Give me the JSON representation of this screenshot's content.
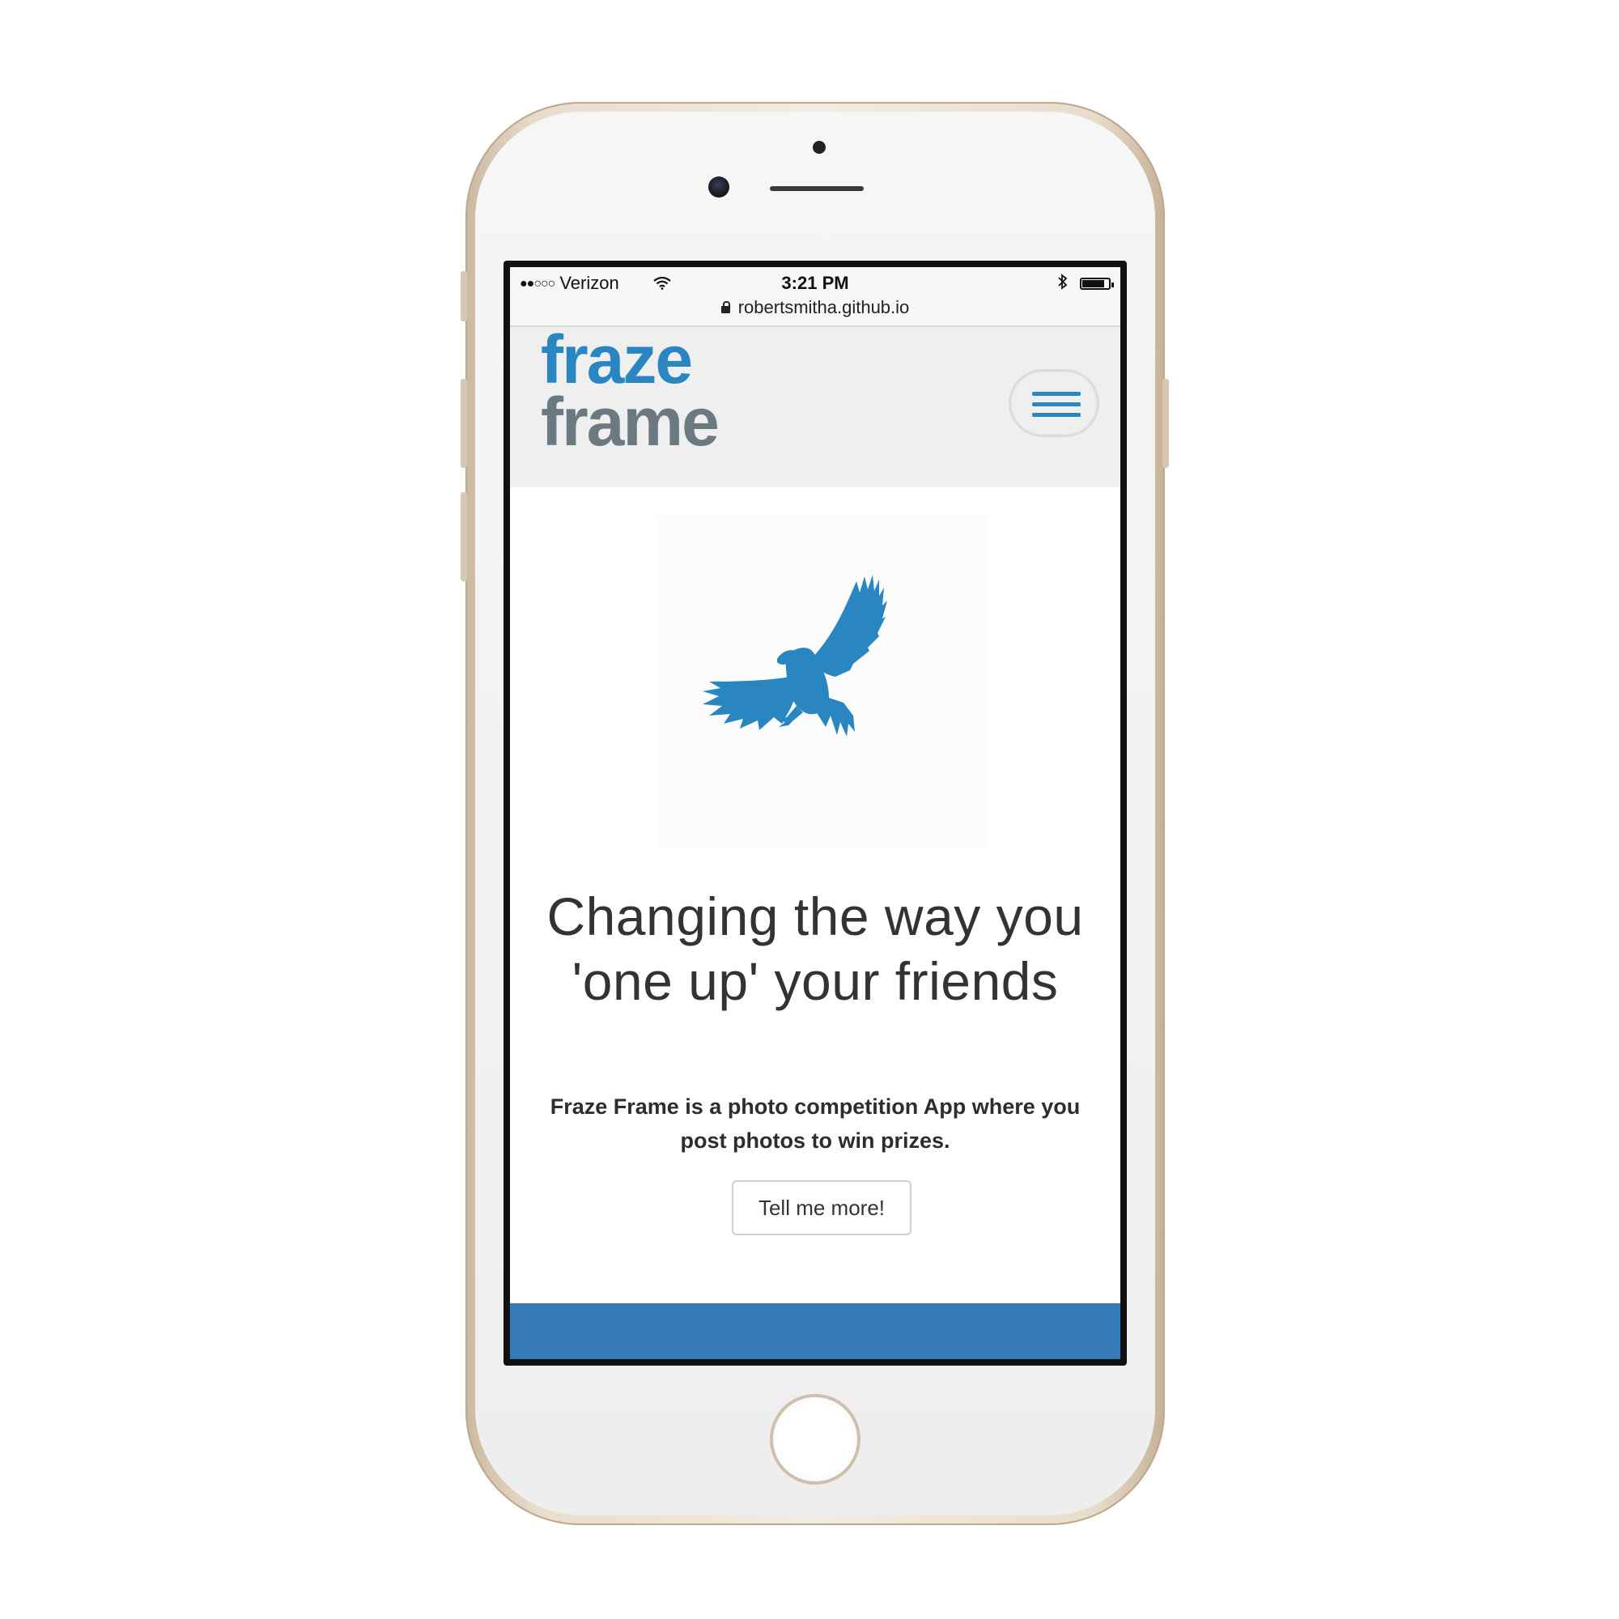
{
  "status_bar": {
    "carrier": "Verizon",
    "time": "3:21 PM"
  },
  "browser": {
    "url": "robertsmitha.github.io"
  },
  "navbar": {
    "brand_line1": "fraze",
    "brand_line2": "frame",
    "menu_icon": "hamburger-menu-icon"
  },
  "hero": {
    "image_icon": "eagle-icon",
    "headline": "Changing the way you 'one up' your friends",
    "lead": "Fraze Frame is a photo competition App where you post photos to win prizes.",
    "button_label": "Tell me more!"
  },
  "colors": {
    "brand_blue": "#2a86c0",
    "brand_gray": "#6b7a80",
    "section_blue": "#347ab6",
    "navbar_bg": "#efefef"
  }
}
